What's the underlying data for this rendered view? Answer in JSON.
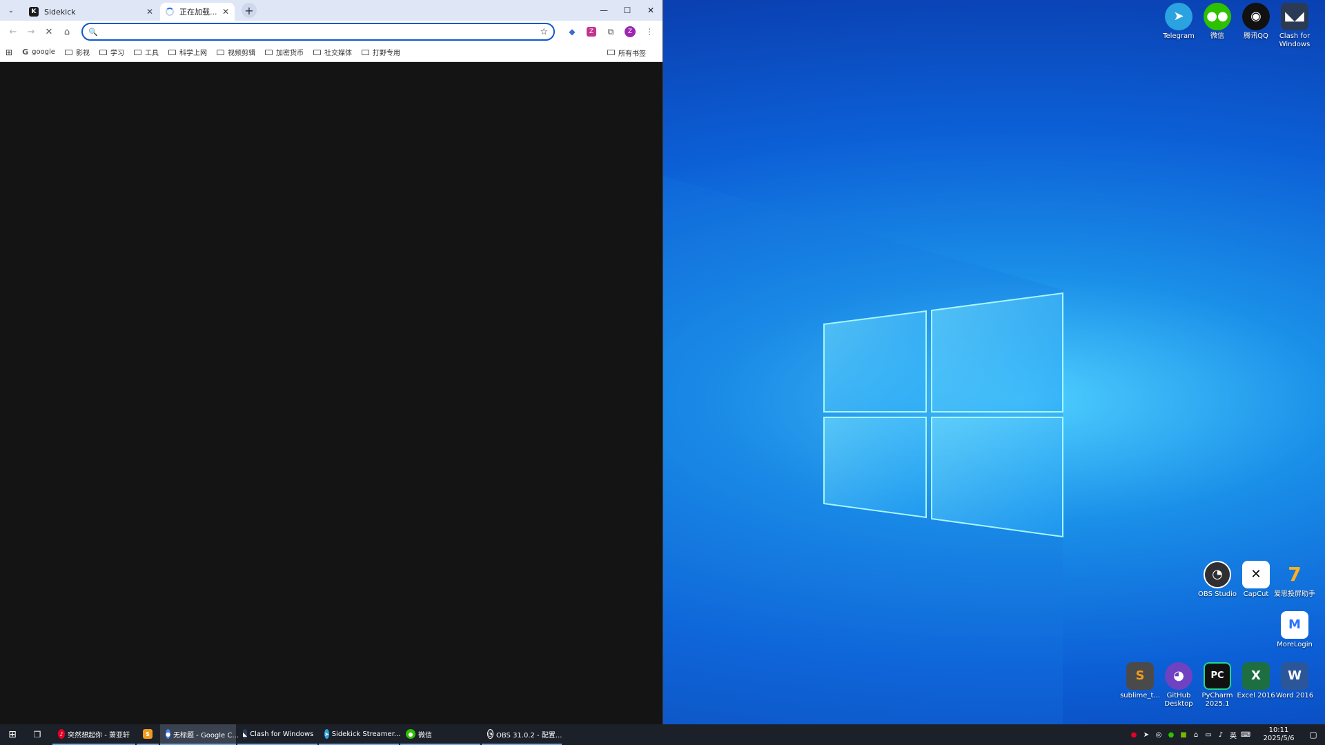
{
  "browser": {
    "tabs": [
      {
        "title": "Sidekick",
        "favicon": "K",
        "active": false
      },
      {
        "title": "正在加载...",
        "active": true
      }
    ],
    "newtab_label": "+",
    "controls": {
      "minimize": "—",
      "maximize": "☐",
      "close": "✕"
    },
    "omnibox": {
      "value": "",
      "placeholder": ""
    },
    "profile_initial": "Z",
    "bookmarks": [
      {
        "label": "google",
        "type": "site"
      },
      {
        "label": "影视",
        "type": "folder"
      },
      {
        "label": "学习",
        "type": "folder"
      },
      {
        "label": "工具",
        "type": "folder"
      },
      {
        "label": "科学上网",
        "type": "folder"
      },
      {
        "label": "视频剪辑",
        "type": "folder"
      },
      {
        "label": "加密货币",
        "type": "folder"
      },
      {
        "label": "社交媒体",
        "type": "folder"
      },
      {
        "label": "打野专用",
        "type": "folder"
      }
    ],
    "all_bookmarks": "所有书签"
  },
  "desktop": {
    "top_icons": [
      {
        "label": "Telegram",
        "icon": "telegram-icon",
        "color": "#2aa3e0"
      },
      {
        "label": "微信",
        "icon": "wechat-icon",
        "color": "#2dc100"
      },
      {
        "label": "腾讯QQ",
        "icon": "qq-icon",
        "color": "#111111"
      },
      {
        "label": "Clash for Windows",
        "icon": "clash-icon",
        "color": "#2b3a55"
      }
    ],
    "mid_icons": [
      {
        "label": "OBS Studio",
        "icon": "obs-icon",
        "color": "#302e31"
      },
      {
        "label": "CapCut",
        "icon": "capcut-icon",
        "color": "#ffffff"
      },
      {
        "label": "爱思投屏助手",
        "icon": "aisi-icon",
        "color": "#1f8fff"
      }
    ],
    "morelogin": {
      "label": "MoreLogin",
      "icon": "morelogin-icon",
      "color": "#ffffff"
    },
    "bottom_icons": [
      {
        "label": "sublime_t...",
        "icon": "sublime-icon",
        "color": "#4a4a4a"
      },
      {
        "label": "GitHub Desktop",
        "icon": "github-icon",
        "color": "#6f42c1"
      },
      {
        "label": "PyCharm 2025.1",
        "icon": "pycharm-icon",
        "color": "#111111"
      },
      {
        "label": "Excel 2016",
        "icon": "excel-icon",
        "color": "#1d6f42"
      },
      {
        "label": "Word 2016",
        "icon": "word-icon",
        "color": "#2b579a"
      }
    ]
  },
  "taskbar": {
    "apps": [
      {
        "label": "突然想起你 - 萧亚轩",
        "icon": "netease-music-icon",
        "color": "#e60026",
        "state": "running"
      },
      {
        "label": "",
        "icon": "sublime-icon",
        "color": "#f29b1f",
        "state": "running"
      },
      {
        "label": "无标题 - Google C...",
        "icon": "chrome-icon",
        "color": "#4285f4",
        "state": "active"
      },
      {
        "label": "Clash for Windows",
        "icon": "clash-icon",
        "color": "#2b3a55",
        "state": "running"
      },
      {
        "label": "Sidekick Streamer...",
        "icon": "telegram-icon",
        "color": "#2aa3e0",
        "state": "running"
      },
      {
        "label": "微信",
        "icon": "wechat-icon",
        "color": "#2dc100",
        "state": "running"
      },
      {
        "label": "OBS 31.0.2 - 配置...",
        "icon": "obs-icon",
        "color": "#302e31",
        "state": "running"
      }
    ],
    "ime": "英",
    "time": "10:11",
    "date": "2025/5/6"
  },
  "colors": {
    "accent": "#0b57d0",
    "tabstrip": "#dfe7f7",
    "taskbar": "#1c2129"
  }
}
